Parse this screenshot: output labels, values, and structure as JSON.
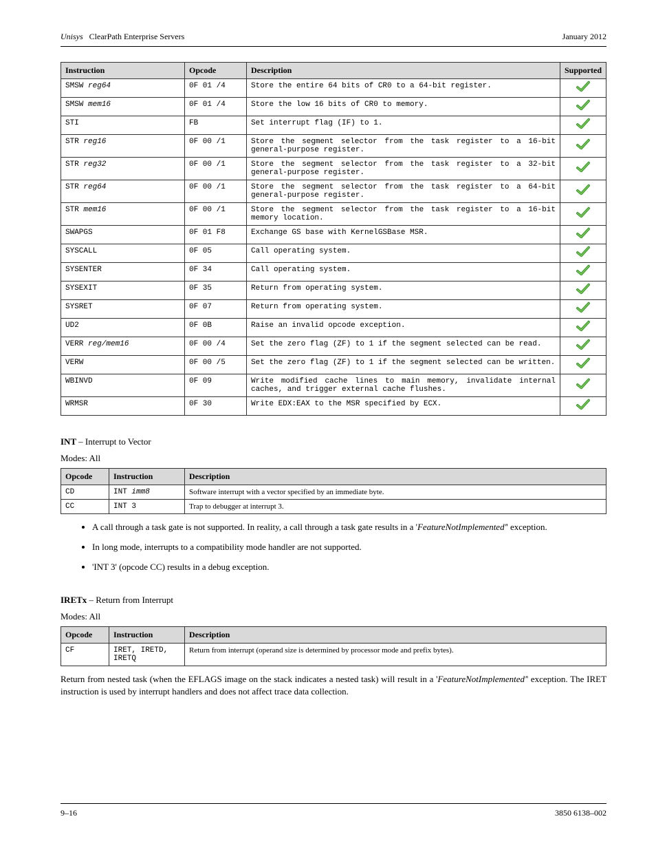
{
  "header": {
    "publisher": "Unisys",
    "title": "ClearPath Enterprise Servers",
    "date": "January 2012",
    "footer_left": "9–16",
    "footer_right": "3850 6138–002"
  },
  "table1": {
    "headers": [
      "Instruction",
      "Opcode",
      "Description",
      "Supported"
    ],
    "rows": [
      {
        "instr": "SMSW ",
        "arg": "reg64",
        "opcode": "0F 01 /4",
        "desc": "Store the entire 64 bits of CR0 to a 64-bit register."
      },
      {
        "instr": "SMSW ",
        "arg": "mem16",
        "opcode": "0F 01 /4",
        "desc": "Store the low 16 bits of CR0 to memory."
      },
      {
        "instr": "STI",
        "arg": "",
        "opcode": "FB",
        "desc": "Set interrupt flag (IF) to 1."
      },
      {
        "instr": "STR ",
        "arg": "reg16",
        "opcode": "0F 00 /1",
        "desc": "Store the segment selector from the task register to a 16-bit general-purpose register."
      },
      {
        "instr": "STR ",
        "arg": "reg32",
        "opcode": "0F 00 /1",
        "desc": "Store the segment selector from the task register to a 32-bit general-purpose register."
      },
      {
        "instr": "STR ",
        "arg": "reg64",
        "opcode": "0F 00 /1",
        "desc": "Store the segment selector from the task register to a 64-bit general-purpose register."
      },
      {
        "instr": "STR ",
        "arg": "mem16",
        "opcode": "0F 00 /1",
        "desc": "Store the segment selector from the task register to a 16-bit memory location."
      },
      {
        "instr": "SWAPGS",
        "arg": "",
        "opcode": "0F 01 F8",
        "desc": "Exchange GS base with KernelGSBase MSR."
      },
      {
        "instr": "SYSCALL",
        "arg": "",
        "opcode": "0F 05",
        "desc": "Call operating system."
      },
      {
        "instr": "SYSENTER",
        "arg": "",
        "opcode": "0F 34",
        "desc": "Call operating system."
      },
      {
        "instr": "SYSEXIT",
        "arg": "",
        "opcode": "0F 35",
        "desc": "Return from operating system."
      },
      {
        "instr": "SYSRET",
        "arg": "",
        "opcode": "0F 07",
        "desc": "Return from operating system."
      },
      {
        "instr": "UD2",
        "arg": "",
        "opcode": "0F 0B",
        "desc": "Raise an invalid opcode exception."
      },
      {
        "instr": "VERR ",
        "arg": "reg/mem16",
        "opcode": "0F 00 /4",
        "desc": "Set the zero flag (ZF) to 1 if the segment selected can be read."
      },
      {
        "instr": "VERW",
        "arg": "",
        "opcode": "0F 00 /5",
        "desc": "Set the zero flag (ZF) to 1 if the segment selected can be written."
      },
      {
        "instr": "WBINVD",
        "arg": "",
        "opcode": "0F 09",
        "desc": "Write modified cache lines to main memory, invalidate internal caches, and trigger external cache flushes."
      },
      {
        "instr": "WRMSR",
        "arg": "",
        "opcode": "0F 30",
        "desc": "Write EDX:EAX to the MSR specified by ECX."
      }
    ]
  },
  "int": {
    "title_a": "INT ",
    "title_b": "– Interrupt to Vector",
    "sub": "Modes: All",
    "headers": [
      "Opcode",
      "Instruction",
      "Description"
    ],
    "rows": [
      {
        "op": "CD",
        "instr": "INT ",
        "arg": "imm8",
        "desc": "Software interrupt with a vector specified by an immediate byte."
      },
      {
        "op": "CC",
        "instr": "INT 3",
        "arg": "",
        "desc": "Trap to debugger at interrupt 3."
      }
    ],
    "notes": [
      {
        "a": "A call through a task gate is not supported. In reality, a call through a task gate results in a '",
        "b": "' exception."
      },
      {
        "a": "",
        "b": "In long mode, interrupts to a compatibility mode handler are not supported."
      },
      {
        "a": "",
        "b": "'INT 3' (opcode CC) results in a debug exception."
      }
    ]
  },
  "iret": {
    "title_a": "IRETx ",
    "title_b": "– Return from Interrupt",
    "sub": "Modes: All",
    "headers": [
      "Opcode",
      "Instruction",
      "Description"
    ],
    "op": "CF",
    "instr": "IRET, IRETD, IRETQ",
    "desc": "Return from interrupt (operand size is determined by processor mode and prefix bytes).",
    "para_a": "Return from nested task (when the EFLAGS image on the stack indicates a nested task) will result in a '",
    "para_b": "' exception. The IRET instruction is used by interrupt handlers and does not affect trace data collection."
  },
  "fni": "FeatureNotImplemented'"
}
